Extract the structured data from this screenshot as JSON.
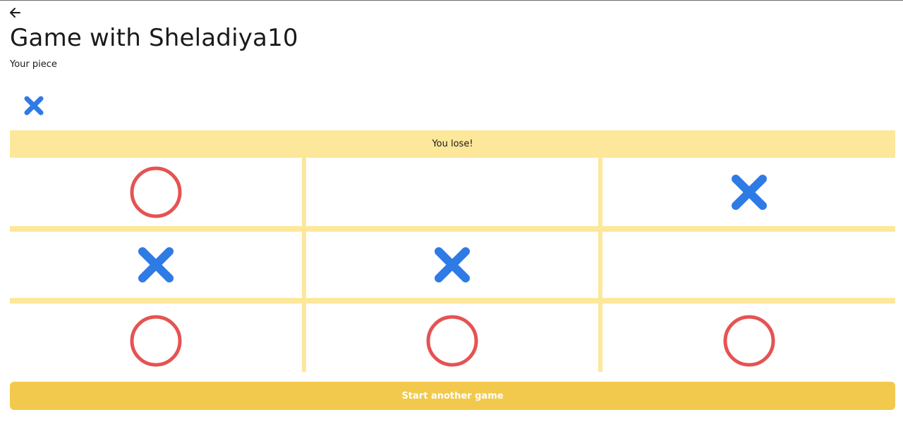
{
  "header": {
    "back_icon": "arrow-left-icon",
    "title": "Game with Sheladiya10",
    "piece_label": "Your piece",
    "player_piece": "X"
  },
  "status": {
    "message": "You lose!"
  },
  "board": {
    "cells": [
      "O",
      "",
      "X",
      "X",
      "X",
      "",
      "O",
      "O",
      "O"
    ]
  },
  "actions": {
    "start_label": "Start another game"
  },
  "colors": {
    "x_piece": "#2f7be6",
    "o_piece": "#e55353",
    "board_lines": "#fde79a",
    "button": "#f2c94c"
  }
}
